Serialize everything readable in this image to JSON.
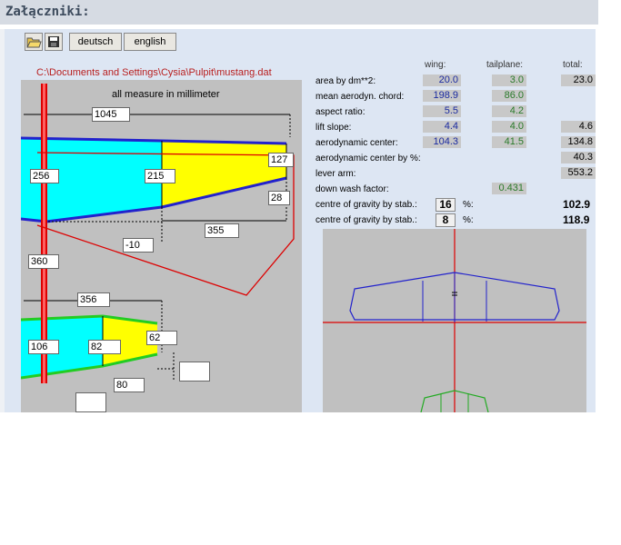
{
  "attachments_title": "Załączniki:",
  "toolbar": {
    "open_icon": "folder-open-icon",
    "save_icon": "floppy-disk-icon",
    "deutsch": "deutsch",
    "english": "english"
  },
  "file_path": "C:\\Documents and Settings\\Cysia\\Pulpit\\mustang.dat",
  "measure_note": "all measure in millimeter",
  "dims": {
    "span": "1045",
    "root_chord": "256",
    "mid_chord": "215",
    "tip_chord": "127",
    "tip_offset": "28",
    "outer_len": "355",
    "sweep": "-10",
    "lever": "360",
    "tail_span": "356",
    "tail_root": "106",
    "tail_mid": "82",
    "tail_tip": "62",
    "tail_len": "80",
    "empty1": "",
    "empty2": ""
  },
  "headers": {
    "wing": "wing:",
    "tailplane": "tailplane:",
    "total": "total:"
  },
  "params": {
    "area_label": "area by dm**2:",
    "area_wing": "20.0",
    "area_tail": "3.0",
    "area_total": "23.0",
    "mac_label": "mean aerodyn. chord:",
    "mac_wing": "198.9",
    "mac_tail": "86.0",
    "ar_label": "aspect ratio:",
    "ar_wing": "5.5",
    "ar_tail": "4.2",
    "lift_label": "lift slope:",
    "lift_wing": "4.4",
    "lift_tail": "4.0",
    "lift_total": "4.6",
    "ac_label": "aerodynamic center:",
    "ac_wing": "104.3",
    "ac_tail": "41.5",
    "ac_total": "134.8",
    "acp_label": "aerodynamic center by %:",
    "acp_total": "40.3",
    "lever_label": "lever arm:",
    "lever_total": "553.2",
    "dw_label": "down wash factor:",
    "dw_tail": "0.431",
    "cg1_label": "centre of gravity by stab.:",
    "cg1_pct": "16",
    "cg1_total": "102.9",
    "cg2_label": "centre of gravity by stab.:",
    "cg2_pct": "8",
    "cg2_total": "118.9",
    "pct_sign": "%:"
  },
  "colors": {
    "wing_fill": "#00ffff",
    "tip_fill": "#ffff00",
    "outline": "#2222cc",
    "fuselage": "#dd0000",
    "tail_outline": "#22cc22",
    "selection": "#dd0000"
  }
}
